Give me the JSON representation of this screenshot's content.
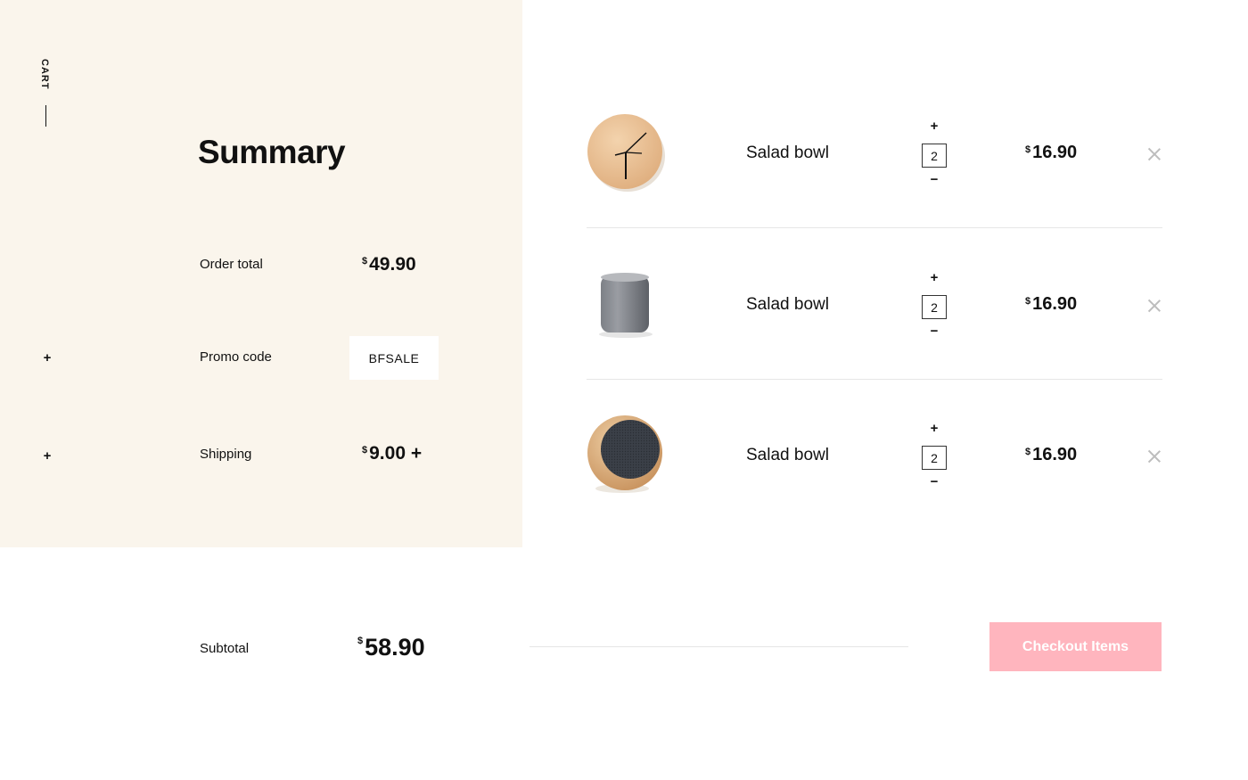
{
  "side": {
    "cart_label": "CART"
  },
  "summary": {
    "title": "Summary",
    "order_total_label": "Order total",
    "order_total_currency": "$",
    "order_total_value": "49.90",
    "promo_label": "Promo code",
    "promo_value": "BFSALE",
    "shipping_label": "Shipping",
    "shipping_currency": "$",
    "shipping_value": "9.00 +",
    "subtotal_label": "Subtotal",
    "subtotal_currency": "$",
    "subtotal_value": "58.90"
  },
  "items": [
    {
      "name": "Salad bowl",
      "qty": "2",
      "currency": "$",
      "price": "16.90",
      "image": "wooden-wall-clock"
    },
    {
      "name": "Salad bowl",
      "qty": "2",
      "currency": "$",
      "price": "16.90",
      "image": "gray-ceramic-cup"
    },
    {
      "name": "Salad bowl",
      "qty": "2",
      "currency": "$",
      "price": "16.90",
      "image": "wooden-speaker"
    }
  ],
  "icons": {
    "plus": "+",
    "minus": "−",
    "remove": "close-icon"
  },
  "checkout": {
    "label": "Checkout Items"
  },
  "colors": {
    "panel_bg": "#faf5ec",
    "accent": "#ffb5be",
    "divider": "#e6e6e6"
  }
}
